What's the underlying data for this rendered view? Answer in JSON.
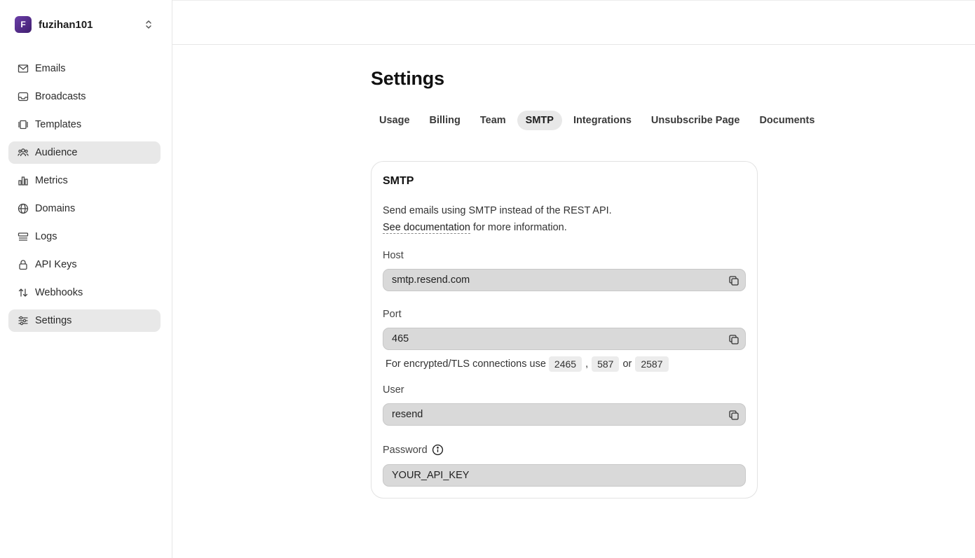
{
  "team": {
    "initial": "F",
    "name": "fuzihan101"
  },
  "sidebar": {
    "items": [
      {
        "label": "Emails",
        "icon": "mail-icon"
      },
      {
        "label": "Broadcasts",
        "icon": "inbox-icon"
      },
      {
        "label": "Templates",
        "icon": "templates-icon"
      },
      {
        "label": "Audience",
        "icon": "users-icon"
      },
      {
        "label": "Metrics",
        "icon": "bar-chart-icon"
      },
      {
        "label": "Domains",
        "icon": "globe-icon"
      },
      {
        "label": "Logs",
        "icon": "logs-icon"
      },
      {
        "label": "API Keys",
        "icon": "lock-icon"
      },
      {
        "label": "Webhooks",
        "icon": "arrows-icon"
      },
      {
        "label": "Settings",
        "icon": "sliders-icon"
      }
    ],
    "active": [
      "Audience",
      "Settings"
    ]
  },
  "page": {
    "title": "Settings"
  },
  "tabs": [
    "Usage",
    "Billing",
    "Team",
    "SMTP",
    "Integrations",
    "Unsubscribe Page",
    "Documents"
  ],
  "active_tab": "SMTP",
  "smtp": {
    "title": "SMTP",
    "desc_line1": "Send emails using SMTP instead of the REST API.",
    "doc_link": "See documentation",
    "desc_line2_rest": " for more information.",
    "host_label": "Host",
    "host_value": "smtp.resend.com",
    "port_label": "Port",
    "port_value": "465",
    "tls_prefix": "For encrypted/TLS connections use",
    "tls_ports": [
      "2465",
      "587",
      "2587"
    ],
    "tls_comma": ",",
    "tls_or": "or",
    "user_label": "User",
    "user_value": "resend",
    "password_label": "Password",
    "password_value": "YOUR_API_KEY"
  },
  "colors": {
    "active_bg": "#e8e8e8",
    "field_bg": "#d9d9d9",
    "avatar": "#5a2f92"
  }
}
